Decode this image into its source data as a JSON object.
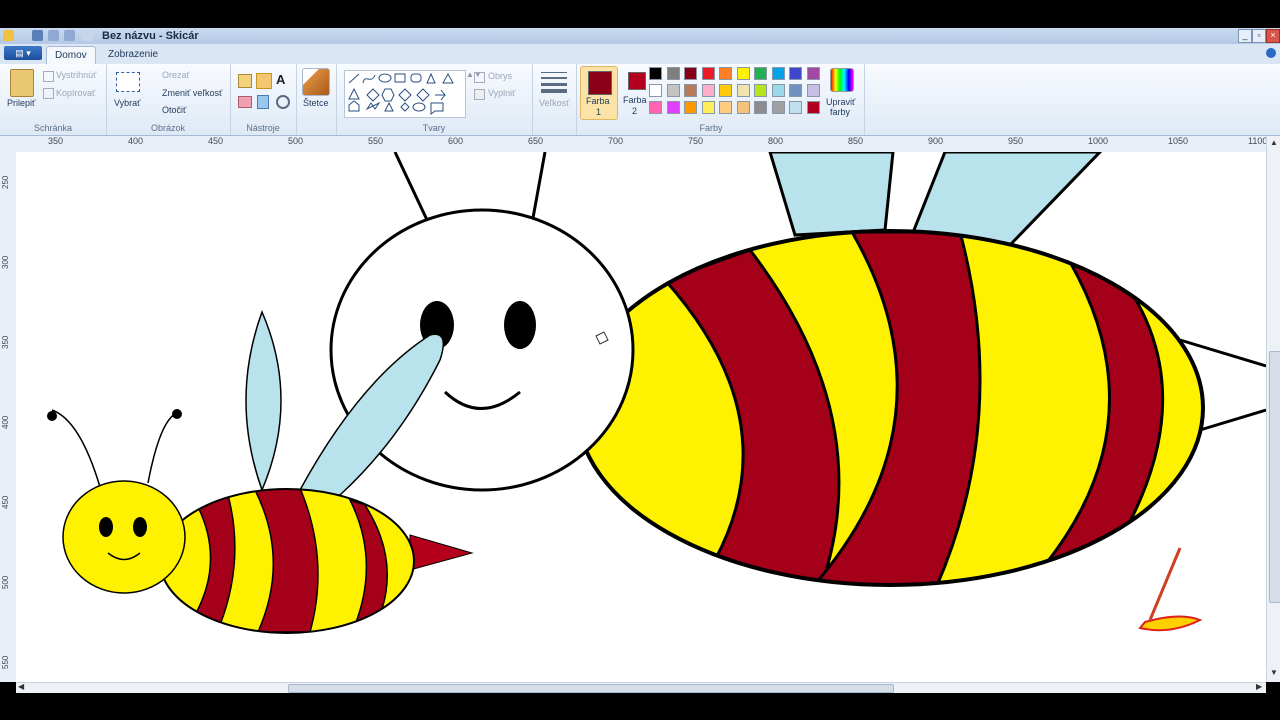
{
  "window": {
    "title": "Bez názvu - Skicár"
  },
  "tabs": [
    {
      "label": "Domov",
      "active": true
    },
    {
      "label": "Zobrazenie",
      "active": false
    }
  ],
  "ribbon": {
    "schranka": {
      "label": "Schránka",
      "paste": "Prilepiť",
      "cut": "Vystrihnúť",
      "copy": "Kopírovať"
    },
    "obrazok": {
      "label": "Obrázok",
      "select": "Vybrať",
      "crop": "Orezať",
      "resize": "Zmeniť veľkosť",
      "rotate": "Otočiť"
    },
    "nastroje": {
      "label": "Nástroje"
    },
    "brushes": {
      "label": "Štetce"
    },
    "tvary": {
      "label": "Tvary",
      "outline": "Obrys",
      "fill": "Vyplniť"
    },
    "size": {
      "label": "Veľkosť"
    },
    "farby": {
      "label": "Farby",
      "color1": "Farba",
      "color1_num": "1",
      "color2": "Farba",
      "color2_num": "2",
      "edit": "Upraviť",
      "edit2": "farby"
    },
    "color1_value": "#8b0016",
    "color2_value": "#b3001f",
    "palette": [
      "#000000",
      "#7f7f7f",
      "#880015",
      "#ed1c24",
      "#ff7f27",
      "#fff200",
      "#22b14c",
      "#00a2e8",
      "#3f48cc",
      "#a349a4",
      "#ffffff",
      "#c3c3c3",
      "#b97a57",
      "#ffaec9",
      "#ffc90e",
      "#efe4b0",
      "#b5e61d",
      "#99d9ea",
      "#7092be",
      "#c8bfe7",
      "#ff66b2",
      "#e040fb",
      "#ff9800",
      "#ffee58",
      "#ffcc80",
      "#f5c27a",
      "#8c8c8c",
      "#a0a0a0",
      "#c0e0f0",
      "#b00020"
    ]
  },
  "ruler": {
    "h": [
      "350",
      "400",
      "450",
      "500",
      "550",
      "600",
      "650",
      "700",
      "750",
      "800",
      "850",
      "900",
      "950",
      "1000",
      "1050",
      "1100"
    ],
    "v": [
      "250",
      "300",
      "350",
      "400",
      "450",
      "500",
      "550"
    ]
  },
  "colors": {
    "bee_red": "#a50019",
    "bee_yellow": "#fff200",
    "wing": "#b8e2ec",
    "stinger": "#b5001c"
  }
}
